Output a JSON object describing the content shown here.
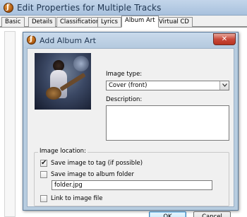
{
  "background_window": {
    "title": "Edit Properties for Multiple Tracks",
    "tabs": [
      {
        "label": "Basic"
      },
      {
        "label": "Details"
      },
      {
        "label": "Classification"
      },
      {
        "label": "Lyrics"
      },
      {
        "label": "Album Art"
      },
      {
        "label": "Virtual CD"
      }
    ],
    "active_tab": "Album Art"
  },
  "dialog": {
    "title": "Add Album Art",
    "close_label": "✕",
    "image_type_label": "Image type:",
    "image_type_value": "Cover (front)",
    "description_label": "Description:",
    "description_value": "",
    "image_location_label": "Image location:",
    "save_to_tag": {
      "label": "Save image to tag (if possible)",
      "checked": true
    },
    "save_to_folder": {
      "label": "Save image to album folder",
      "checked": false
    },
    "folder_filename": "folder.jpg",
    "link_to_file": {
      "label": "Link to image file",
      "checked": false
    },
    "ok_label": "OK",
    "cancel_label": "Cancel"
  },
  "colors": {
    "titlebar": "#b4c9de",
    "close_button": "#c9493a",
    "dialog_face": "#f0f0f0"
  },
  "icons": {
    "app": "mediamonkey-app-icon",
    "dropdown": "chevron-down-icon",
    "check": "checkmark-icon"
  }
}
